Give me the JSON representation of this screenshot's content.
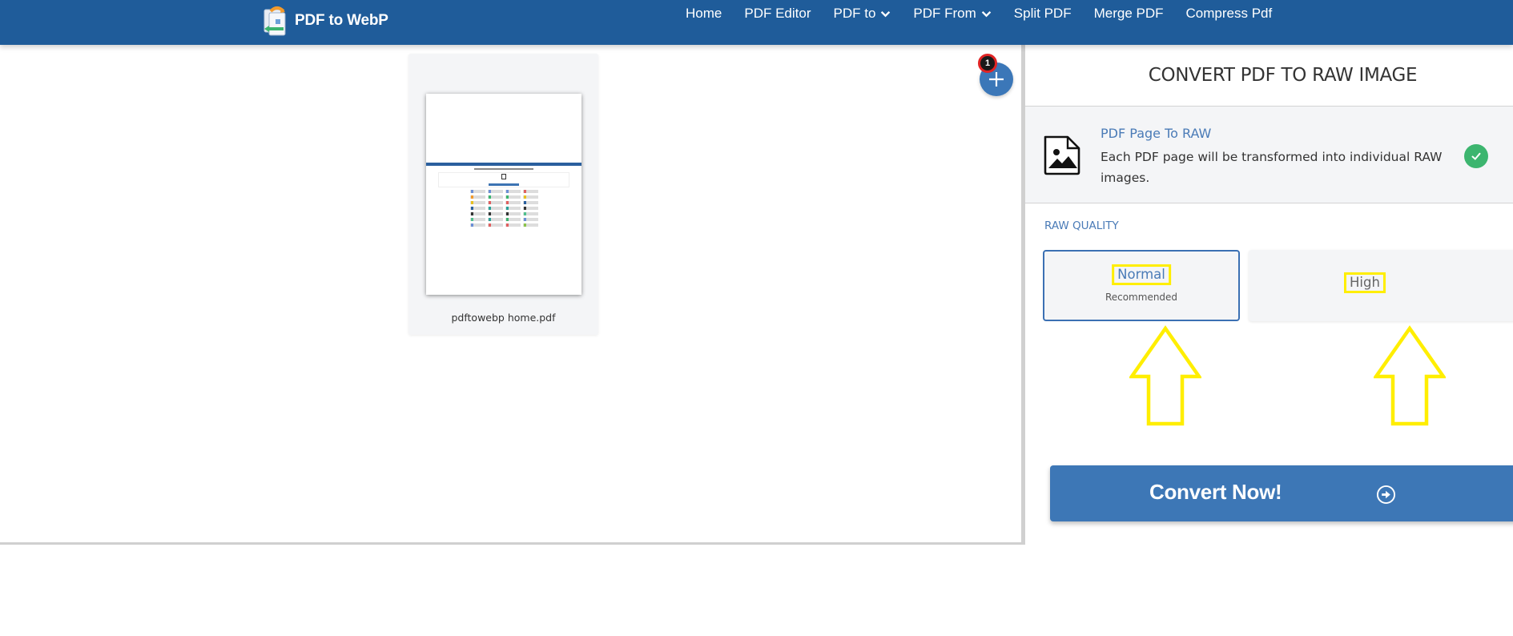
{
  "header": {
    "logo_text": "PDF to WebP",
    "nav": [
      {
        "label": "Home",
        "dropdown": false
      },
      {
        "label": "PDF Editor",
        "dropdown": false
      },
      {
        "label": "PDF to",
        "dropdown": true
      },
      {
        "label": "PDF From",
        "dropdown": true
      },
      {
        "label": "Split PDF",
        "dropdown": false
      },
      {
        "label": "Merge PDF",
        "dropdown": false
      },
      {
        "label": "Compress Pdf",
        "dropdown": false
      }
    ]
  },
  "workspace": {
    "files": [
      {
        "name": "pdftowebp home.pdf"
      }
    ],
    "file_count_badge": "1",
    "add_icon": "plus-icon"
  },
  "panel": {
    "title": "CONVERT PDF TO RAW IMAGE",
    "feature": {
      "icon": "image-file-icon",
      "title": "PDF Page To RAW",
      "description": "Each PDF page will be transformed into individual RAW images.",
      "selected": true
    },
    "quality": {
      "label": "RAW QUALITY",
      "options": [
        {
          "name": "Normal",
          "sub": "Recommended",
          "selected": true
        },
        {
          "name": "High",
          "sub": "",
          "selected": false
        }
      ]
    },
    "convert_button": "Convert Now!"
  },
  "colors": {
    "navbar": "#1f5c9a",
    "accent": "#3d77b6",
    "success": "#3cb56f",
    "badge_border": "#e02424",
    "highlight": "#ffee00"
  }
}
